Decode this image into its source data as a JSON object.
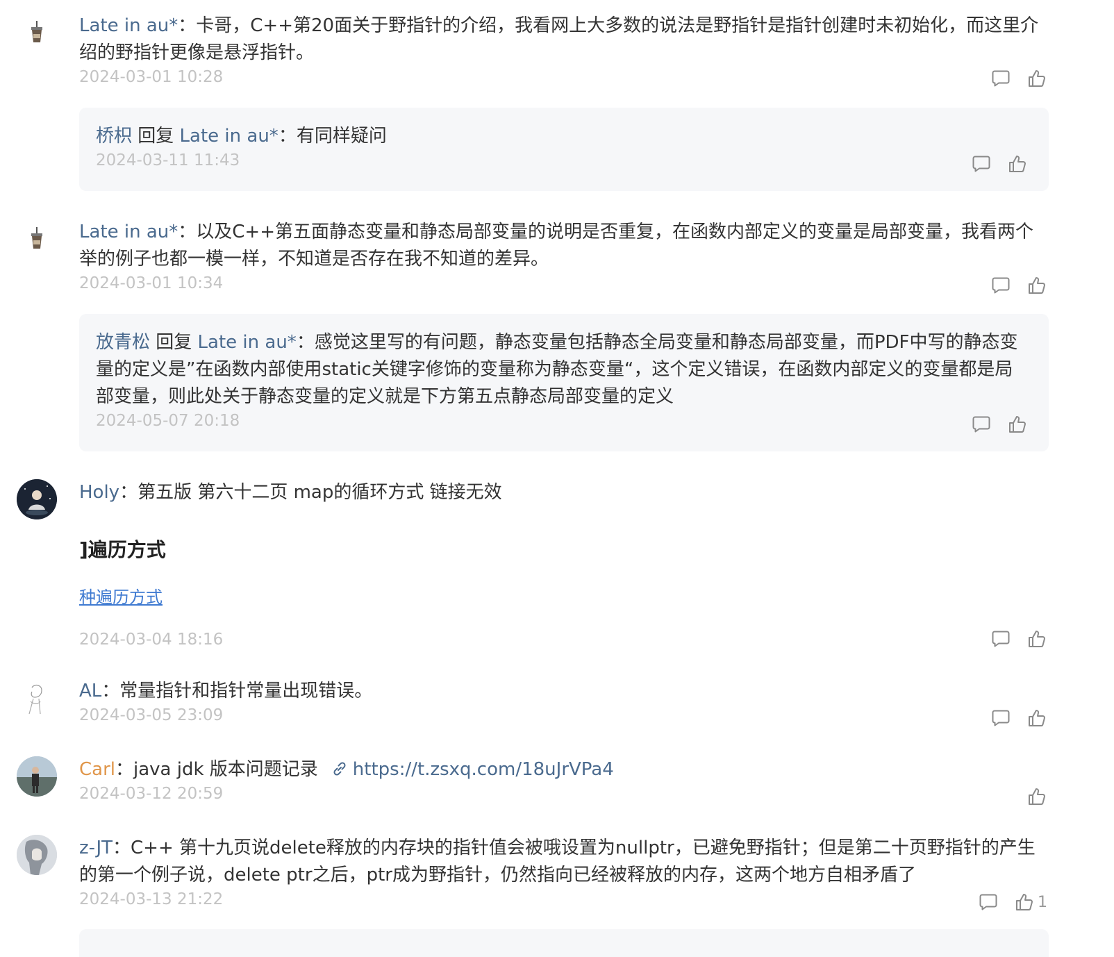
{
  "comments": [
    {
      "user": "Late in au*",
      "text": "：卡哥，C++第20面关于野指针的介绍，我看网上大多数的说法是野指针是指针创建时未初始化，而这里介绍的野指针更像是悬浮指针。",
      "time": "2024-03-01 10:28",
      "reply": {
        "user": "桥枳",
        "reply_word": " 回复 ",
        "target": "Late in au*",
        "text": "：有同样疑问",
        "time": "2024-03-11 11:43"
      }
    },
    {
      "user": "Late in au*",
      "text": "：以及C++第五面静态变量和静态局部变量的说明是否重复，在函数内部定义的变量是局部变量，我看两个举的例子也都一模一样，不知道是否存在我不知道的差异。",
      "time": "2024-03-01 10:34",
      "reply": {
        "user": "放青松",
        "reply_word": " 回复 ",
        "target": "Late in au*",
        "text": "：感觉这里写的有问题，静态变量包括静态全局变量和静态局部变量，而PDF中写的静态变量的定义是”在函数内部使用static关键字修饰的变量称为静态变量“，这个定义错误，在函数内部定义的变量都是局部变量，则此处关于静态变量的定义就是下方第五点静态局部变量的定义",
        "time": "2024-05-07 20:18"
      }
    },
    {
      "user": "Holy",
      "text": "：第五版 第六十二页 map的循环方式 链接无效",
      "embed_title": "]遍历方式",
      "embed_link": "种遍历方式",
      "time": "2024-03-04 18:16"
    },
    {
      "user": "AL",
      "text": "：常量指针和指针常量出现错误。",
      "time": "2024-03-05 23:09"
    },
    {
      "user": "Carl",
      "text": "：java jdk 版本问题记录",
      "link": "https://t.zsxq.com/18uJrVPa4",
      "time": "2024-03-12 20:59"
    },
    {
      "user": "z-JT",
      "text": "：C++ 第十九页说delete释放的内存块的指针值会被哦设置为nullptr，已避免野指针；但是第二十页野指针的产生的第一个例子说，delete ptr之后，ptr成为野指针，仍然指向已经被释放的内存，这两个地方自相矛盾了",
      "time": "2024-03-13 21:22",
      "likes": "1"
    }
  ],
  "icons": [
    "comment-icon",
    "like-icon",
    "link-icon",
    "cup-avatar-icon"
  ],
  "colors": {
    "name": "#4a6a8e",
    "author": "#e0964a",
    "time": "#c3c3c3",
    "reply_bg": "#f6f7f9",
    "link": "#3f7ad1"
  }
}
